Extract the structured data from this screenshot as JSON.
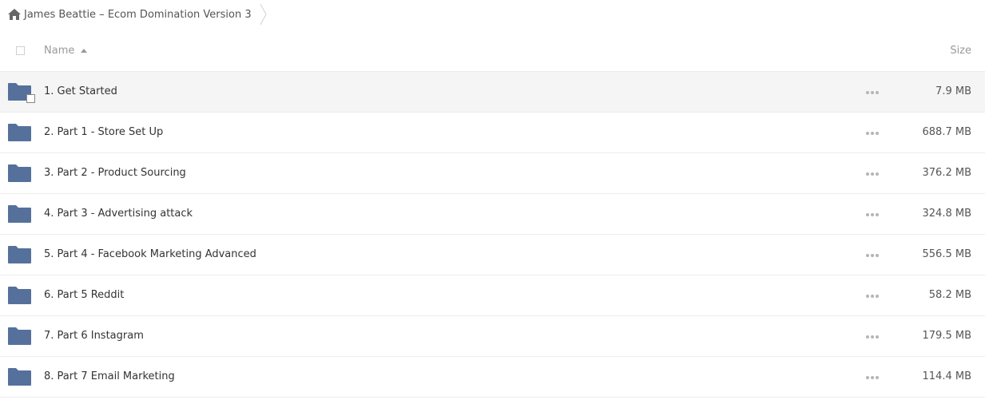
{
  "breadcrumb": {
    "home_icon": "home-icon",
    "path": "James Beattie – Ecom Domination Version 3",
    "separator_icon": "chevron-right-icon"
  },
  "header": {
    "name_label": "Name",
    "size_label": "Size",
    "sort_icon": "sort-ascending-icon"
  },
  "colors": {
    "folder": "#55719b",
    "row_hover": "#f5f5f5",
    "border": "#ededed"
  },
  "rows": [
    {
      "name": "1. Get Started",
      "size": "7.9 MB",
      "icon": "folder-icon"
    },
    {
      "name": "2. Part 1 - Store Set Up",
      "size": "688.7 MB",
      "icon": "folder-icon"
    },
    {
      "name": "3. Part 2 - Product Sourcing",
      "size": "376.2 MB",
      "icon": "folder-icon"
    },
    {
      "name": "4. Part 3 - Advertising attack",
      "size": "324.8 MB",
      "icon": "folder-icon"
    },
    {
      "name": "5. Part 4 - Facebook Marketing Advanced",
      "size": "556.5 MB",
      "icon": "folder-icon"
    },
    {
      "name": "6. Part 5 Reddit",
      "size": "58.2 MB",
      "icon": "folder-icon"
    },
    {
      "name": "7. Part 6 Instagram",
      "size": "179.5 MB",
      "icon": "folder-icon"
    },
    {
      "name": "8. Part 7 Email Marketing",
      "size": "114.4 MB",
      "icon": "folder-icon"
    }
  ]
}
